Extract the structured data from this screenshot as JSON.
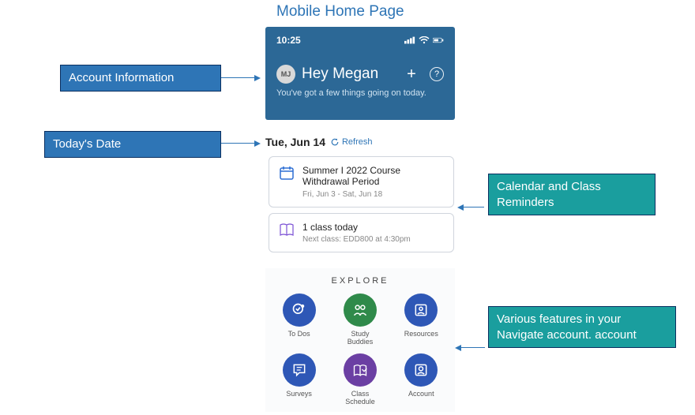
{
  "title": "Mobile Home Page",
  "callouts": {
    "account": "Account Information",
    "date": "Today's Date",
    "reminders": "Calendar and Class Reminders",
    "features": "Various features in your Navigate account. account"
  },
  "status": {
    "time": "10:25"
  },
  "header": {
    "avatar_initials": "MJ",
    "greeting": "Hey Megan",
    "subtext": "You've got a few things going on today."
  },
  "date_row": {
    "date": "Tue, Jun 14",
    "refresh_label": "Refresh"
  },
  "cards": [
    {
      "title": "Summer I 2022 Course Withdrawal Period",
      "sub": "Fri, Jun 3 - Sat, Jun 18"
    },
    {
      "title": "1 class today",
      "sub": "Next class: EDD800 at 4:30pm"
    }
  ],
  "explore": {
    "title": "EXPLORE",
    "items": [
      {
        "label": "To Dos",
        "color": "blue",
        "icon": "todos"
      },
      {
        "label": "Study Buddies",
        "color": "green",
        "icon": "buddies"
      },
      {
        "label": "Resources",
        "color": "blue",
        "icon": "resources"
      },
      {
        "label": "Surveys",
        "color": "blue",
        "icon": "surveys"
      },
      {
        "label": "Class Schedule",
        "color": "purple",
        "icon": "schedule"
      },
      {
        "label": "Account",
        "color": "blue",
        "icon": "account"
      }
    ]
  }
}
